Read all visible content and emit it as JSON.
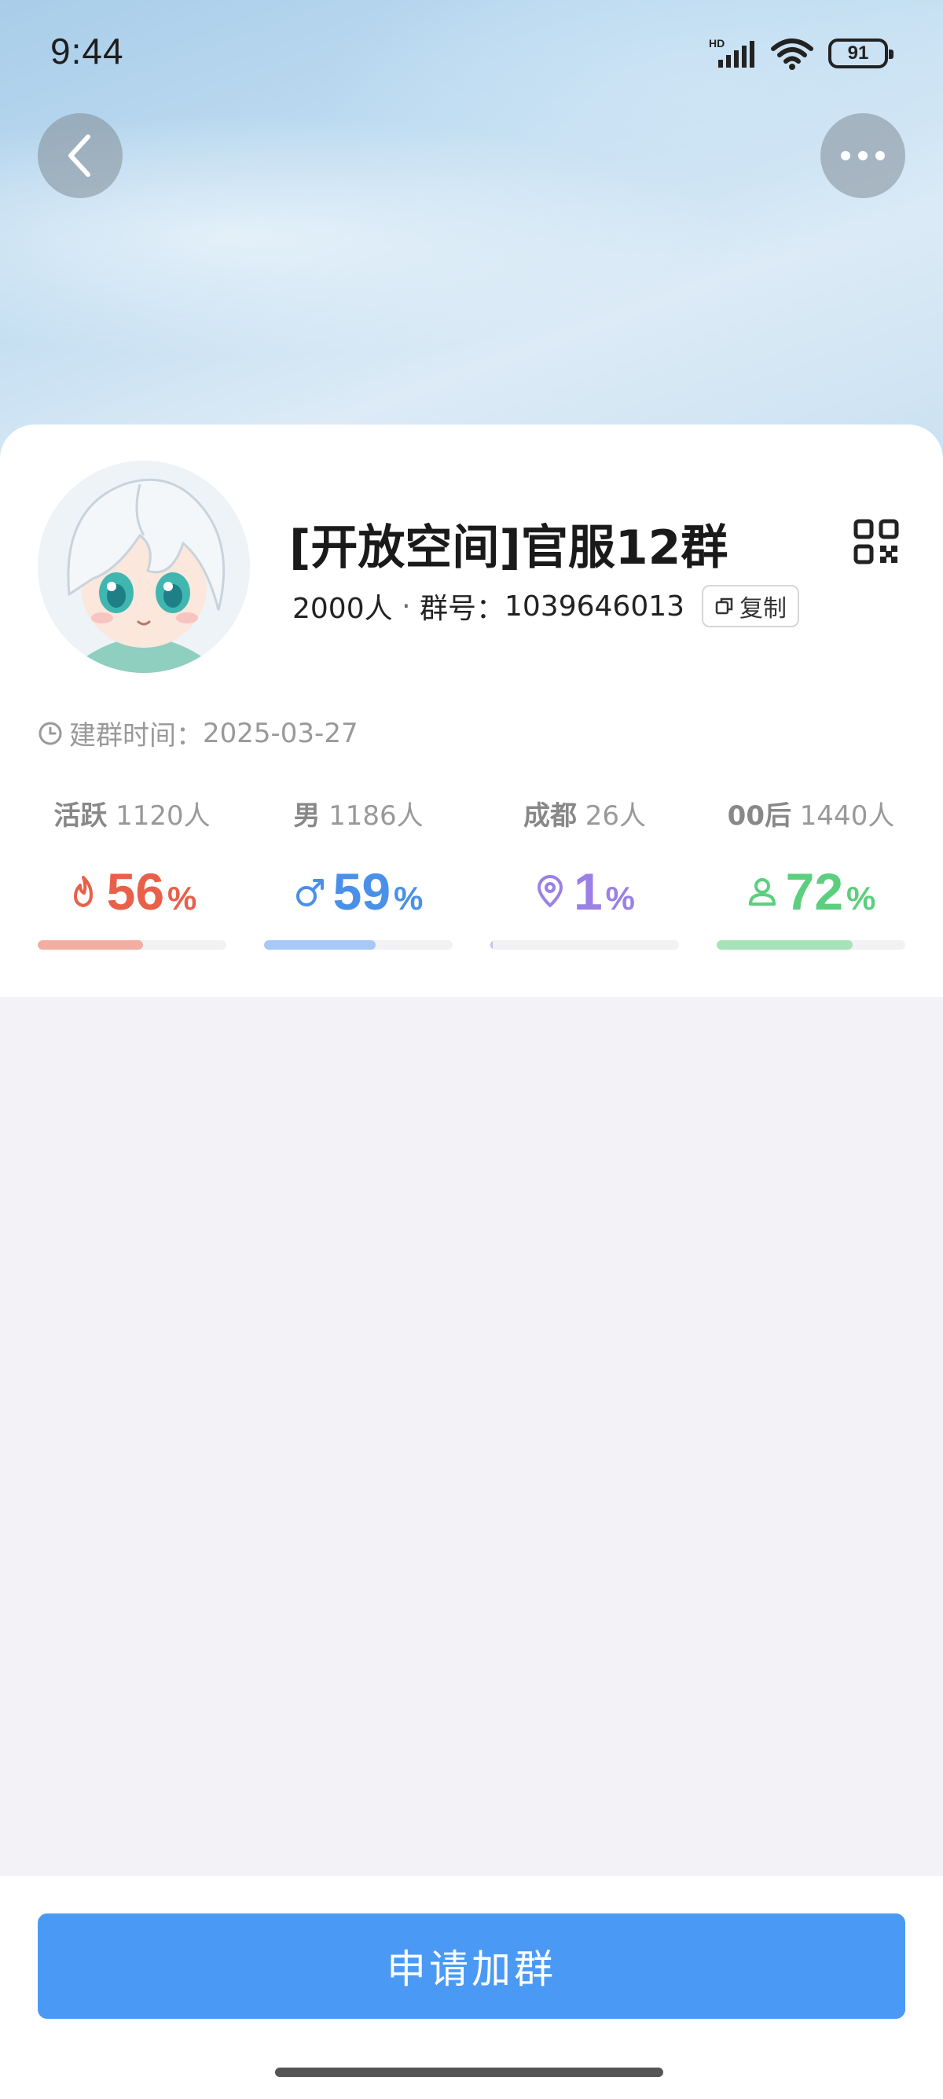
{
  "status_bar": {
    "time": "9:44",
    "network": "HD",
    "battery": "91"
  },
  "group": {
    "name": "[开放空间]官服12群",
    "members": "2000人",
    "separator": " · ",
    "id_label": "群号：",
    "id": "1039646013",
    "copy_label": "复制",
    "created_label": "建群时间：",
    "created_date": "2025-03-27"
  },
  "stats": [
    {
      "key": "活跃",
      "count": "1120人",
      "value": "56",
      "unit": "%",
      "fraction": 0.56,
      "color": "#e9604a",
      "bar_color": "#f4aea1",
      "icon": "flame-icon"
    },
    {
      "key": "男",
      "count": "1186人",
      "value": "59",
      "unit": "%",
      "fraction": 0.59,
      "color": "#4a90e8",
      "bar_color": "#a8c9f5",
      "icon": "male-icon"
    },
    {
      "key": "成都",
      "count": "26人",
      "value": "1",
      "unit": "%",
      "fraction": 0.01,
      "color": "#9b80e6",
      "bar_color": "#c9bbf3",
      "icon": "location-pin-icon"
    },
    {
      "key": "00后",
      "count": "1440人",
      "value": "72",
      "unit": "%",
      "fraction": 0.72,
      "color": "#5ccf7e",
      "bar_color": "#a6e3b8",
      "icon": "person-icon"
    }
  ],
  "actions": {
    "join_label": "申请加群"
  },
  "colors": {
    "primary": "#4a9af5"
  }
}
